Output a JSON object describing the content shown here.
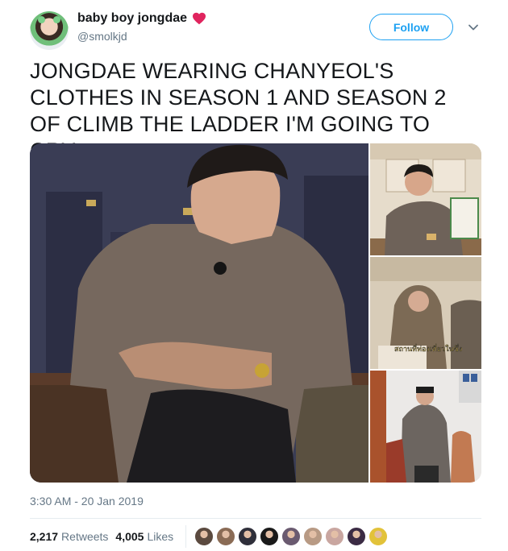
{
  "author": {
    "name": "baby boy jongdae",
    "handle": "@smolkjd",
    "badge_icon": "heart-icon",
    "badge_color": "#e0245e"
  },
  "follow_label": "Follow",
  "tweet_text": "JONGDAE WEARING CHANYEOL'S CLOTHES IN SEASON 1 AND SEASON 2 OF CLIMB THE LADDER I'M GOING TO CRY",
  "media": {
    "photo_count": 4,
    "subtitle_text": "สถานที่ท่องเที่ยวในซึ่ง"
  },
  "timestamp": "3:30 AM - 20 Jan 2019",
  "stats": {
    "retweets_count": "2,217",
    "retweets_label": "Retweets",
    "likes_count": "4,005",
    "likes_label": "Likes"
  },
  "liker_avatar_colors": [
    "#5b4a3f",
    "#8a6b55",
    "#2f2f3a",
    "#1a1a1a",
    "#6a5a70",
    "#b89a84",
    "#c9a6a0",
    "#3b2b44",
    "#e2c23a"
  ],
  "colors": {
    "accent": "#1da1f2",
    "text": "#14171a",
    "secondary": "#657786"
  }
}
